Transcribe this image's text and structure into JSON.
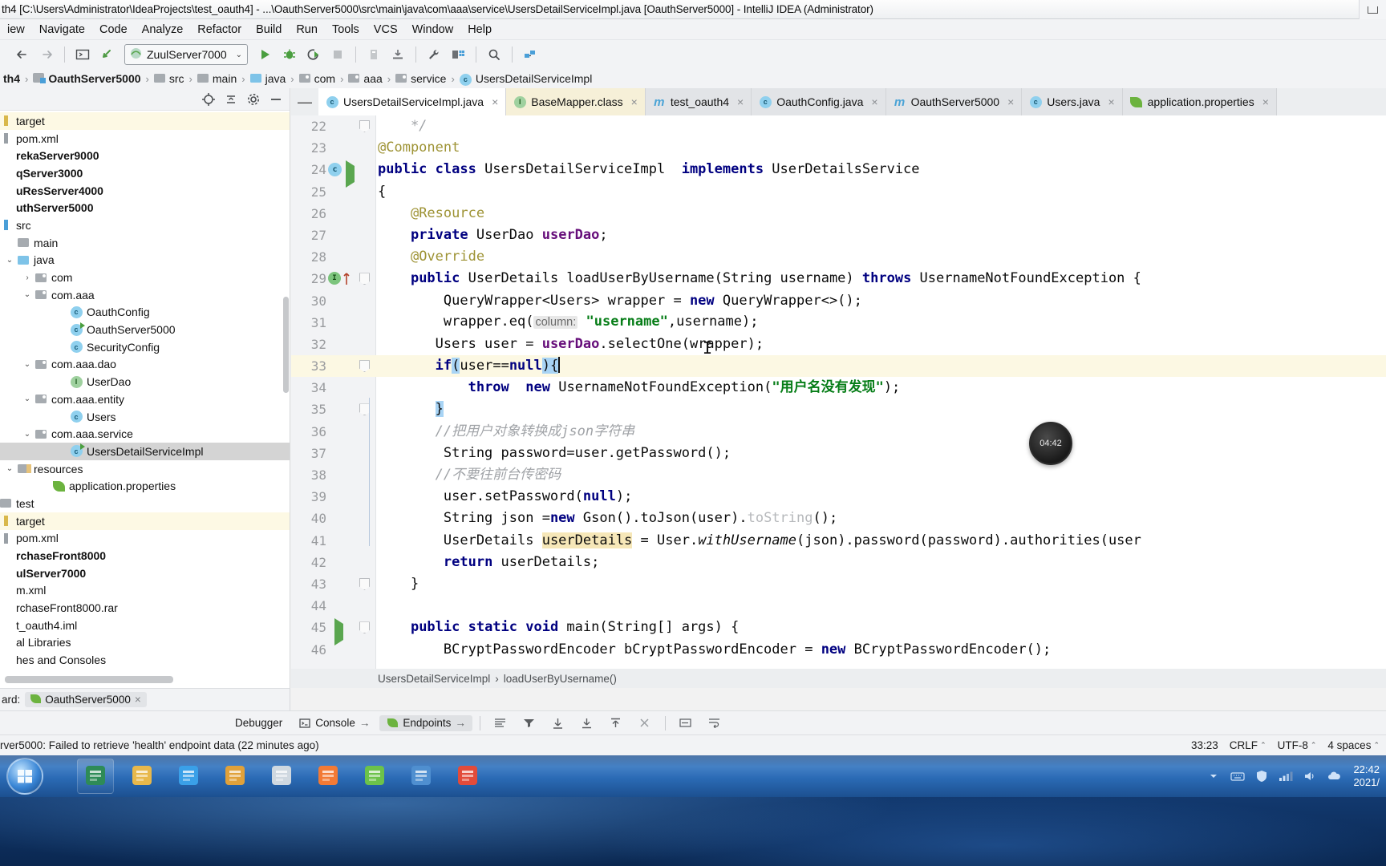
{
  "window": {
    "title": "th4 [C:\\Users\\Administrator\\IdeaProjects\\test_oauth4] - ...\\OauthServer5000\\src\\main\\java\\com\\aaa\\service\\UsersDetailServiceImpl.java [OauthServer5000] - IntelliJ IDEA (Administrator)",
    "minimize_label": "minimize"
  },
  "menu": {
    "items": [
      {
        "label": "iew"
      },
      {
        "label": "Navigate"
      },
      {
        "label": "Code"
      },
      {
        "label": "Analyze"
      },
      {
        "label": "Refactor"
      },
      {
        "label": "Build"
      },
      {
        "label": "Run"
      },
      {
        "label": "Tools"
      },
      {
        "label": "VCS"
      },
      {
        "label": "Window"
      },
      {
        "label": "Help"
      }
    ]
  },
  "toolbar": {
    "run_config": "ZuulServer7000",
    "caret": "⌄",
    "back_icon": "←",
    "forward_icon": "→"
  },
  "breadcrumb": {
    "items": [
      {
        "label": "th4",
        "bold": true,
        "icon": "none"
      },
      {
        "label": "OauthServer5000",
        "bold": true,
        "icon": "module"
      },
      {
        "label": "src",
        "bold": false,
        "icon": "folder"
      },
      {
        "label": "main",
        "bold": false,
        "icon": "folder"
      },
      {
        "label": "java",
        "bold": false,
        "icon": "folder-blue"
      },
      {
        "label": "com",
        "bold": false,
        "icon": "package"
      },
      {
        "label": "aaa",
        "bold": false,
        "icon": "package"
      },
      {
        "label": "service",
        "bold": false,
        "icon": "package"
      },
      {
        "label": "UsersDetailServiceImpl",
        "bold": false,
        "icon": "class"
      }
    ],
    "separator": "›"
  },
  "project_tree": {
    "rows": [
      {
        "label": "target",
        "indent": 0,
        "arrow": "",
        "icon": "xml-target",
        "style": "warn"
      },
      {
        "label": "pom.xml",
        "indent": 0,
        "arrow": "",
        "icon": "xml",
        "style": ""
      },
      {
        "label": "rekaServer9000",
        "indent": 0,
        "arrow": "",
        "icon": "none",
        "style": "bold"
      },
      {
        "label": "qServer3000",
        "indent": 0,
        "arrow": "",
        "icon": "none",
        "style": "bold"
      },
      {
        "label": "uResServer4000",
        "indent": 0,
        "arrow": "",
        "icon": "none",
        "style": "bold"
      },
      {
        "label": "uthServer5000",
        "indent": 0,
        "arrow": "",
        "icon": "none",
        "style": "bold"
      },
      {
        "label": "src",
        "indent": 0,
        "arrow": "",
        "icon": "src",
        "style": ""
      },
      {
        "label": "main",
        "indent": 1,
        "arrow": "",
        "icon": "folder",
        "style": ""
      },
      {
        "label": "java",
        "indent": 1,
        "arrow": "⌄",
        "icon": "folder-blue",
        "style": ""
      },
      {
        "label": "com",
        "indent": 2,
        "arrow": "›",
        "icon": "package",
        "style": ""
      },
      {
        "label": "com.aaa",
        "indent": 2,
        "arrow": "⌄",
        "icon": "package",
        "style": ""
      },
      {
        "label": "OauthConfig",
        "indent": 4,
        "arrow": "",
        "icon": "class",
        "style": ""
      },
      {
        "label": "OauthServer5000",
        "indent": 4,
        "arrow": "",
        "icon": "class-run",
        "style": ""
      },
      {
        "label": "SecurityConfig",
        "indent": 4,
        "arrow": "",
        "icon": "class",
        "style": ""
      },
      {
        "label": "com.aaa.dao",
        "indent": 2,
        "arrow": "⌄",
        "icon": "package",
        "style": ""
      },
      {
        "label": "UserDao",
        "indent": 4,
        "arrow": "",
        "icon": "interface",
        "style": ""
      },
      {
        "label": "com.aaa.entity",
        "indent": 2,
        "arrow": "⌄",
        "icon": "package",
        "style": ""
      },
      {
        "label": "Users",
        "indent": 4,
        "arrow": "",
        "icon": "class",
        "style": ""
      },
      {
        "label": "com.aaa.service",
        "indent": 2,
        "arrow": "⌄",
        "icon": "package",
        "style": ""
      },
      {
        "label": "UsersDetailServiceImpl",
        "indent": 4,
        "arrow": "",
        "icon": "class-run",
        "style": "sel"
      },
      {
        "label": "resources",
        "indent": 1,
        "arrow": "⌄",
        "icon": "resources",
        "style": ""
      },
      {
        "label": "application.properties",
        "indent": 3,
        "arrow": "",
        "icon": "leaf",
        "style": ""
      },
      {
        "label": "test",
        "indent": 0,
        "arrow": "",
        "icon": "folder",
        "style": ""
      },
      {
        "label": "target",
        "indent": 0,
        "arrow": "",
        "icon": "xml-target",
        "style": "warn"
      },
      {
        "label": "pom.xml",
        "indent": 0,
        "arrow": "",
        "icon": "xml",
        "style": ""
      },
      {
        "label": "rchaseFront8000",
        "indent": 0,
        "arrow": "",
        "icon": "none",
        "style": "bold"
      },
      {
        "label": "ulServer7000",
        "indent": 0,
        "arrow": "",
        "icon": "none",
        "style": "bold"
      },
      {
        "label": "m.xml",
        "indent": 0,
        "arrow": "",
        "icon": "none",
        "style": ""
      },
      {
        "label": "rchaseFront8000.rar",
        "indent": 0,
        "arrow": "",
        "icon": "none",
        "style": ""
      },
      {
        "label": "t_oauth4.iml",
        "indent": 0,
        "arrow": "",
        "icon": "none",
        "style": ""
      },
      {
        "label": "al Libraries",
        "indent": 0,
        "arrow": "",
        "icon": "none",
        "style": ""
      },
      {
        "label": "hes and Consoles",
        "indent": 0,
        "arrow": "",
        "icon": "none",
        "style": ""
      }
    ]
  },
  "editor_tabs": [
    {
      "label": "UsersDetailServiceImpl.java",
      "icon": "class",
      "state": "active",
      "close": "×"
    },
    {
      "label": "BaseMapper.class",
      "icon": "interface",
      "state": "modified",
      "close": "×"
    },
    {
      "label": "test_oauth4",
      "icon": "maven",
      "state": "",
      "close": "×"
    },
    {
      "label": "OauthConfig.java",
      "icon": "class",
      "state": "",
      "close": "×"
    },
    {
      "label": "OauthServer5000",
      "icon": "maven",
      "state": "",
      "close": "×"
    },
    {
      "label": "Users.java",
      "icon": "class",
      "state": "",
      "close": "×"
    },
    {
      "label": "application.properties",
      "icon": "leaf",
      "state": "",
      "close": "×"
    }
  ],
  "code": {
    "first_line": 22,
    "lines": [
      {
        "n": 22,
        "html": "<span class=\"cmt\">    */</span>",
        "fold": "end",
        "gutter": ""
      },
      {
        "n": 23,
        "html": "<span class=\"ann\">@Component</span>",
        "fold": "",
        "gutter": ""
      },
      {
        "n": 24,
        "html": "<span class=\"kw\">public class</span> UsersDetailServiceImpl  <span class=\"kw\">implements</span> UserDetailsService",
        "fold": "",
        "gutter": "class-run"
      },
      {
        "n": 25,
        "html": "{",
        "fold": "",
        "gutter": ""
      },
      {
        "n": 26,
        "html": "    <span class=\"ann\">@Resource</span>",
        "fold": "",
        "gutter": ""
      },
      {
        "n": 27,
        "html": "    <span class=\"kw\">private</span> UserDao <span class=\"fld\">userDao</span>;",
        "fold": "",
        "gutter": ""
      },
      {
        "n": 28,
        "html": "    <span class=\"ann\">@Override</span>",
        "fold": "",
        "gutter": ""
      },
      {
        "n": 29,
        "html": "    <span class=\"kw\">public</span> UserDetails loadUserByUsername(String username) <span class=\"kw\">throws</span> UsernameNotFoundException {",
        "fold": "start",
        "gutter": "override"
      },
      {
        "n": 30,
        "html": "        QueryWrapper&lt;Users&gt; wrapper = <span class=\"kw\">new</span> QueryWrapper&lt;&gt;();",
        "fold": "",
        "gutter": ""
      },
      {
        "n": 31,
        "html": "        wrapper.eq(<span class=\"hint\">column:</span> <span class=\"str\">\"username\"</span>,username);",
        "fold": "",
        "gutter": ""
      },
      {
        "n": 32,
        "html": "       Users user = <span class=\"fld\">userDao</span>.selectOne(wrapper);",
        "fold": "",
        "gutter": ""
      },
      {
        "n": 33,
        "html": "       <span class=\"kw\">if</span><span class=\"brk\">(</span>user==<span class=\"kw\">null</span><span class=\"brk\">)</span><span class=\"brk\">{</span><span class=\"caret\"></span>",
        "fold": "start",
        "gutter": "",
        "highlight": true
      },
      {
        "n": 34,
        "html": "           <span class=\"kw\">throw</span>  <span class=\"kw\">new</span> UsernameNotFoundException(<span class=\"str\">\"用户名没有发现\"</span>);",
        "fold": "",
        "gutter": ""
      },
      {
        "n": 35,
        "html": "       <span class=\"brk\">}</span>",
        "fold": "end",
        "gutter": ""
      },
      {
        "n": 36,
        "html": "       <span class=\"cmt\">//把用户对象转换成json字符串</span>",
        "fold": "",
        "gutter": ""
      },
      {
        "n": 37,
        "html": "        String password=user.getPassword();",
        "fold": "",
        "gutter": ""
      },
      {
        "n": 38,
        "html": "       <span class=\"cmt\">//不要往前台传密码</span>",
        "fold": "",
        "gutter": ""
      },
      {
        "n": 39,
        "html": "        user.setPassword(<span class=\"kw\">null</span>);",
        "fold": "",
        "gutter": ""
      },
      {
        "n": 40,
        "html": "        String json =<span class=\"kw\">new</span> Gson().toJson(user).<span class=\"dim\">toString</span>();",
        "fold": "",
        "gutter": ""
      },
      {
        "n": 41,
        "html": "        UserDetails <span class=\"idhl\">userDetails</span> = User.<span class=\"ital\">withUsername</span>(json).password(password).authorities(user",
        "fold": "",
        "gutter": ""
      },
      {
        "n": 42,
        "html": "        <span class=\"kw\">return</span> userDetails;",
        "fold": "",
        "gutter": ""
      },
      {
        "n": 43,
        "html": "    }",
        "fold": "end",
        "gutter": ""
      },
      {
        "n": 44,
        "html": "",
        "fold": "",
        "gutter": ""
      },
      {
        "n": 45,
        "html": "    <span class=\"kw\">public static void</span> main(String[] args) {",
        "fold": "start",
        "gutter": "run"
      },
      {
        "n": 46,
        "html": "        BCryptPasswordEncoder bCryptPasswordEncoder = <span class=\"kw\">new</span> BCryptPasswordEncoder();",
        "fold": "",
        "gutter": ""
      }
    ]
  },
  "clock_widget": {
    "time": "04:42"
  },
  "editor_breadcrumb": {
    "class": "UsersDetailServiceImpl",
    "separator": "›",
    "method": "loadUserByUsername()"
  },
  "left_bottom": {
    "label": "ard:",
    "chip": "OauthServer5000",
    "close": "×"
  },
  "bottom_toolwindows": {
    "items": [
      {
        "label": "Debugger",
        "icon": "",
        "active": false
      },
      {
        "label": "Console",
        "icon": "console-icon",
        "active": false
      },
      {
        "label": "→",
        "icon": "",
        "active": false
      },
      {
        "label": "Endpoints",
        "icon": "endpoints-icon",
        "active": true
      },
      {
        "label": "→",
        "icon": "",
        "active": false
      }
    ],
    "tool_icons": [
      "list-icon",
      "filter-icon",
      "scroll-down-icon",
      "download-icon",
      "upload-icon",
      "clear-icon",
      "wrap-icon",
      "soft-wrap-icon"
    ]
  },
  "statusbar": {
    "message": "rver5000: Failed to retrieve 'health' endpoint data (22 minutes ago)",
    "caret_position": "33:23",
    "line_separator": "CRLF",
    "encoding": "UTF-8",
    "indent": "4 spaces",
    "caret_glyph": "⌃"
  },
  "taskbar": {
    "apps": [
      {
        "name": "windows-explorer-icon",
        "color": "#2e8b57"
      },
      {
        "name": "file-manager-icon",
        "color": "#e8b84b"
      },
      {
        "name": "media-player-icon",
        "color": "#3aa0e8"
      },
      {
        "name": "calculator-icon",
        "color": "#e0a13a"
      },
      {
        "name": "notes-icon",
        "color": "#cfd8e0"
      },
      {
        "name": "intellij-idea-icon",
        "color": "#f27a35"
      },
      {
        "name": "browser-icon",
        "color": "#6cc24a"
      },
      {
        "name": "terminal-icon",
        "color": "#4f8fd0"
      },
      {
        "name": "editor-icon",
        "color": "#e24b3a"
      }
    ],
    "tray": {
      "time": "22:42",
      "date": "2021/"
    }
  },
  "colors": {
    "accent": "#2a6fbd",
    "keyword": "#000080",
    "string": "#067d17",
    "annotation": "#9e9335",
    "field": "#660e7a",
    "comment": "#a0a3a7",
    "highlight_line": "#fcf8e3"
  }
}
